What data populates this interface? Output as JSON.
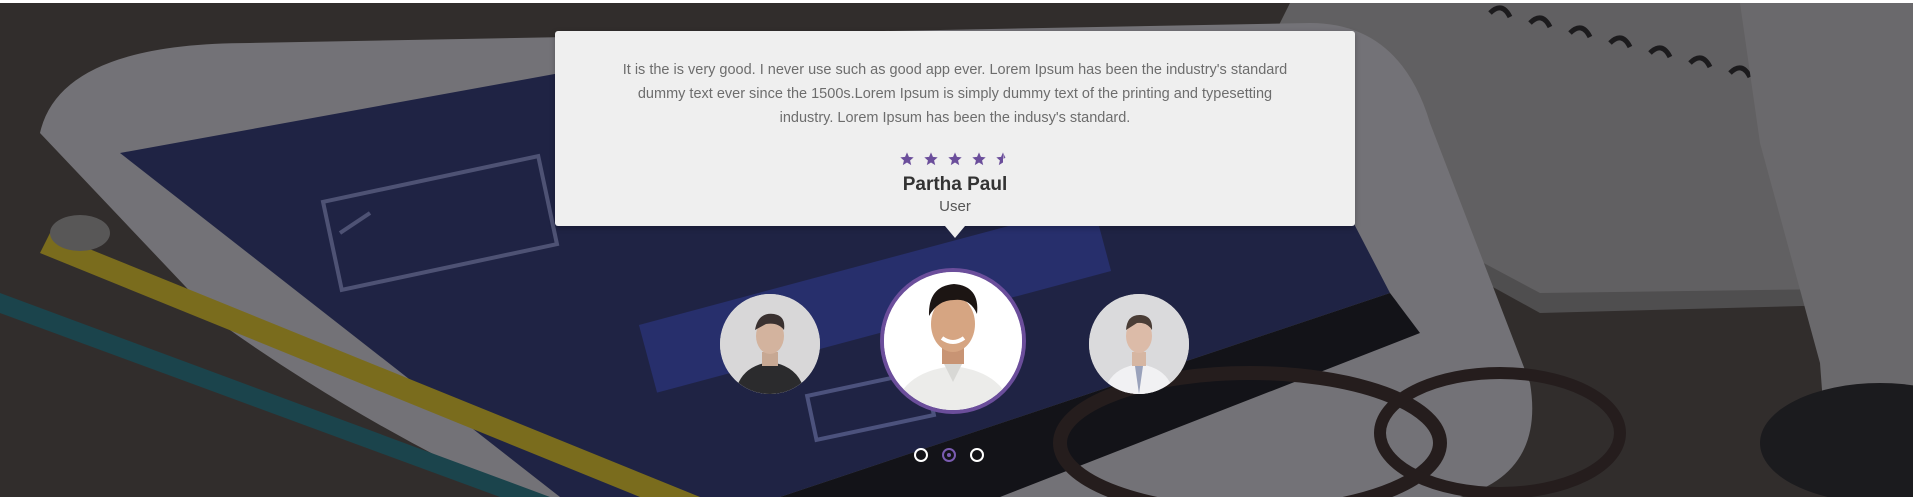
{
  "testimonial": {
    "quote": "It is the is very good. I never use such as good app ever. Lorem Ipsum has been the industry's standard dummy text ever since the 1500s.Lorem Ipsum is simply dummy text of the printing and typesetting industry. Lorem Ipsum has been the indusy's standard.",
    "rating": 4.5,
    "rating_max": 5,
    "name": "Partha Paul",
    "role": "User"
  },
  "carousel": {
    "slides": 3,
    "active_index": 1
  },
  "colors": {
    "accent": "#6b4e9b",
    "card": "#efefef",
    "dot": "#ffffff"
  },
  "icons": {
    "star": "star-icon",
    "half_star": "half-star-icon"
  }
}
